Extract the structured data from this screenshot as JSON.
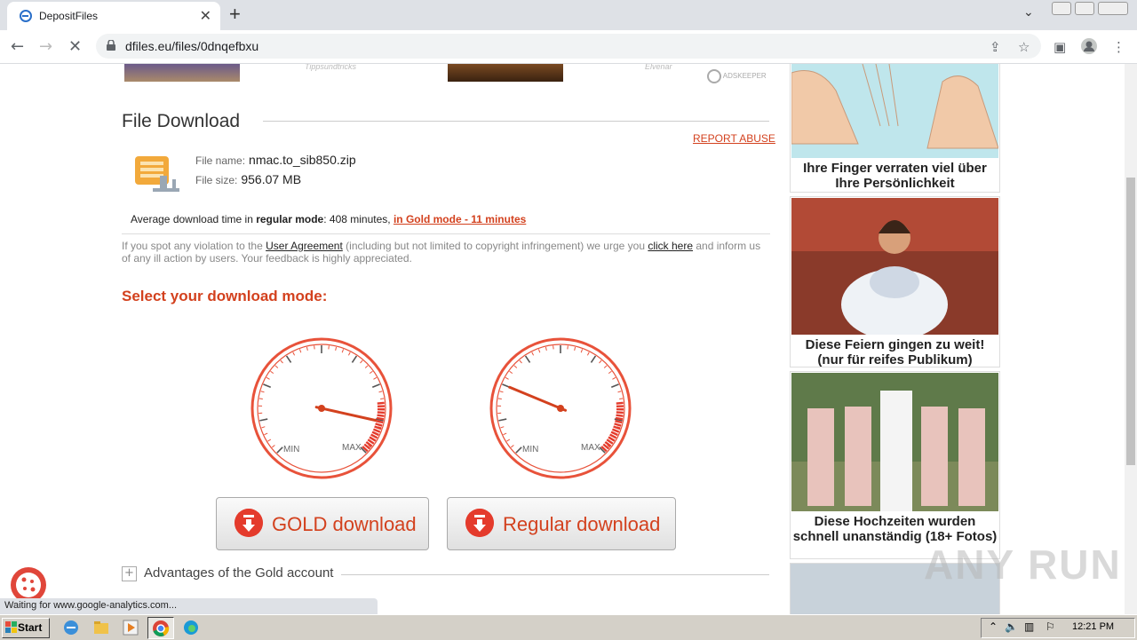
{
  "browser": {
    "tab_title": "DepositFiles",
    "new_tab": "+",
    "url": "dfiles.eu/files/0dnqefbxu"
  },
  "top_ads": {
    "caption1": "Tippsundtricks",
    "caption2": "Elvenar",
    "network": "ADSKEEPER"
  },
  "main": {
    "title": "File Download",
    "report_abuse": "REPORT ABUSE",
    "file_name_label": "File name:",
    "file_name": "nmac.to_sib850.zip",
    "file_size_label": "File size:",
    "file_size": "956.07 MB",
    "avg_prefix": "Average download time in ",
    "avg_regular_mode": "regular mode",
    "avg_regular_time": ": 408 minutes, ",
    "avg_gold_link": "in Gold mode - 11 minutes",
    "violation_1": "If you spot any violation to the ",
    "user_agreement": "User Agreement",
    "violation_2": " (including but not limited to copyright infringement) we urge you ",
    "click_here": "click here",
    "violation_3": " and inform us of any ill action by users. Your feedback is highly appreciated.",
    "select_mode": "Select your download mode:",
    "gauge_min": "MIN",
    "gauge_max": "MAX",
    "gold_speed": 0.88,
    "regular_speed": 0.25,
    "gold_button": "GOLD download",
    "regular_button": "Regular download",
    "advantages": "Advantages of the Gold account"
  },
  "side_ads": [
    {
      "caption": "Ihre Finger verraten viel über Ihre Persönlichkeit"
    },
    {
      "caption": "Diese Feiern gingen zu weit! (nur für reifes Publikum)"
    },
    {
      "caption": "Diese Hochzeiten wurden schnell unanständig (18+ Fotos)"
    }
  ],
  "status": "Waiting for www.google-analytics.com...",
  "watermark": "ANY RUN",
  "taskbar": {
    "start": "Start",
    "clock": "12:21 PM"
  },
  "colors": {
    "accent": "#d3411e",
    "gauge": "#e8523a"
  }
}
